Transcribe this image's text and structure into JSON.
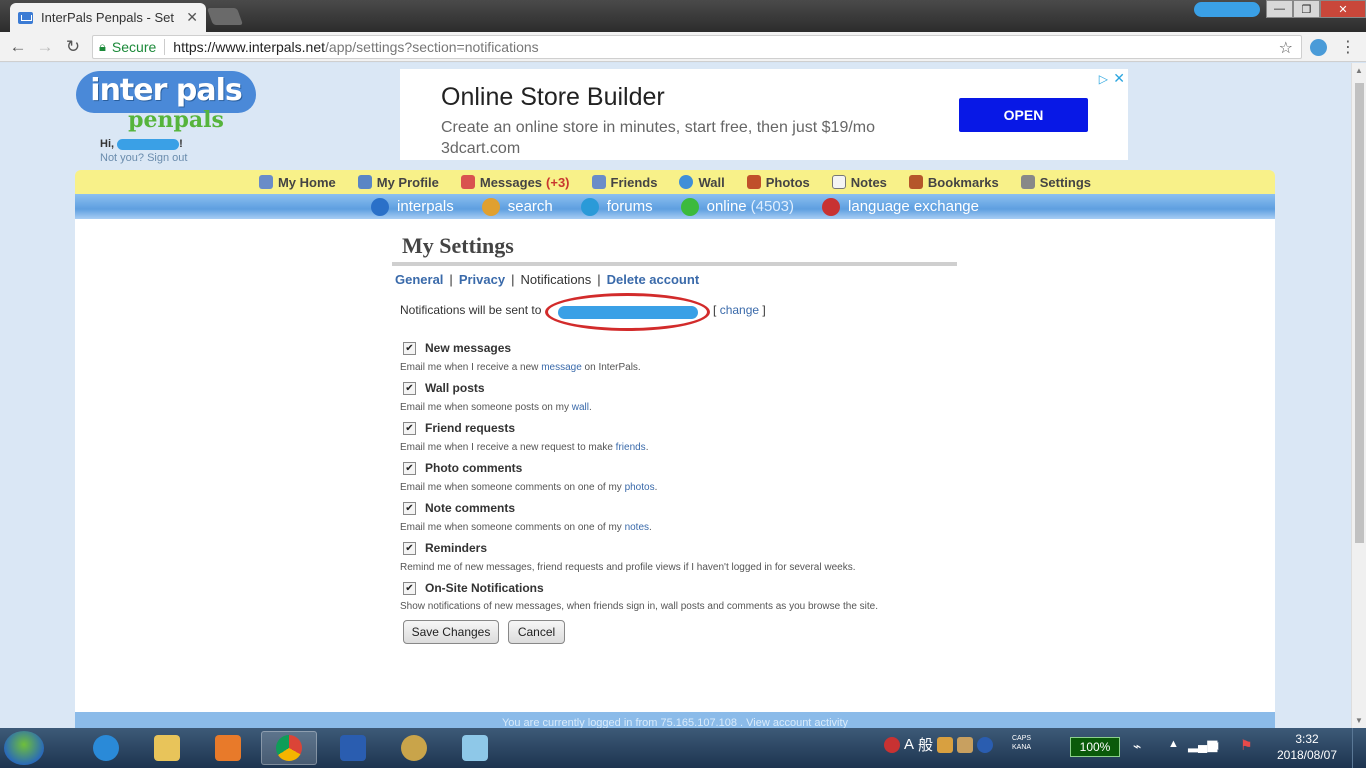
{
  "browser": {
    "tab_title": "InterPals Penpals - Set",
    "tab_close": "✕",
    "secure_label": "Secure",
    "url_host": "https://www.interpals.net",
    "url_path": "/app/settings?section=notifications"
  },
  "site": {
    "logo_top": "inter pals",
    "logo_sub": "penpals",
    "greeting_prefix": "Hi,",
    "greeting_suffix": "!",
    "not_you": "Not you?",
    "sign_out": "Sign out"
  },
  "ad": {
    "headline": "Online Store Builder",
    "body": "Create an online store in minutes, start free, then just $19/mo",
    "domain": "3dcart.com",
    "button": "OPEN"
  },
  "nav": {
    "items": [
      {
        "label": "My Home",
        "color": "#6a8cc8"
      },
      {
        "label": "My Profile",
        "color": "#5a86c5"
      },
      {
        "label": "Messages",
        "count": "(+3)",
        "color": "#d9534f"
      },
      {
        "label": "Friends",
        "color": "#6a8cc8"
      },
      {
        "label": "Wall",
        "color": "#3f8fd8"
      },
      {
        "label": "Photos",
        "color": "#c0502a"
      },
      {
        "label": "Notes",
        "color": "#dddddd"
      },
      {
        "label": "Bookmarks",
        "color": "#b5562a"
      },
      {
        "label": "Settings",
        "color": "#888888"
      }
    ]
  },
  "subnav": {
    "items": [
      {
        "label": "interpals",
        "color": "#2a70c8"
      },
      {
        "label": "search",
        "color": "#e0a030"
      },
      {
        "label": "forums",
        "color": "#2a9ad8"
      },
      {
        "label": "online",
        "count": "(4503)",
        "color": "#3cba3c"
      },
      {
        "label": "language exchange",
        "color": "#c83232"
      }
    ]
  },
  "settings": {
    "title": "My Settings",
    "tabs": [
      {
        "label": "General"
      },
      {
        "label": "Privacy"
      },
      {
        "label": "Notifications"
      },
      {
        "label": "Delete account"
      }
    ],
    "notify_prefix": "Notifications will be sent to",
    "change_open": "[",
    "change_label": "change",
    "change_close": "]",
    "options": [
      {
        "label": "New messages",
        "desc_a": "Email me when I receive a new",
        "link": "message",
        "desc_b": "on InterPals.",
        "checked": true
      },
      {
        "label": "Wall posts",
        "desc_a": "Email me when someone posts on my",
        "link": "wall",
        "desc_b": ".",
        "checked": true
      },
      {
        "label": "Friend requests",
        "desc_a": "Email me when I receive a new request to make",
        "link": "friends",
        "desc_b": ".",
        "checked": true
      },
      {
        "label": "Photo comments",
        "desc_a": "Email me when someone comments on one of my",
        "link": "photos",
        "desc_b": ".",
        "checked": true
      },
      {
        "label": "Note comments",
        "desc_a": "Email me when someone comments on one of my",
        "link": "notes",
        "desc_b": ".",
        "checked": true
      },
      {
        "label": "Reminders",
        "desc_a": "Remind me of new messages, friend requests and profile views if I haven't logged in for several weeks.",
        "link": "",
        "desc_b": "",
        "checked": true
      },
      {
        "label": "On-Site Notifications",
        "desc_a": "Show notifications of new messages, when friends sign in, wall posts and comments as you browse the site.",
        "link": "",
        "desc_b": "",
        "checked": true
      }
    ],
    "save_button": "Save Changes",
    "cancel_button": "Cancel"
  },
  "footer": {
    "text": "You are currently logged in from 75.165.107.108 .  View account activity"
  },
  "taskbar": {
    "ime_a": "A",
    "ime_kanji": "般",
    "caps_line1": "CAPS",
    "caps_line2": "KANA",
    "battery": "100%",
    "time": "3:32",
    "date": "2018/08/07"
  }
}
